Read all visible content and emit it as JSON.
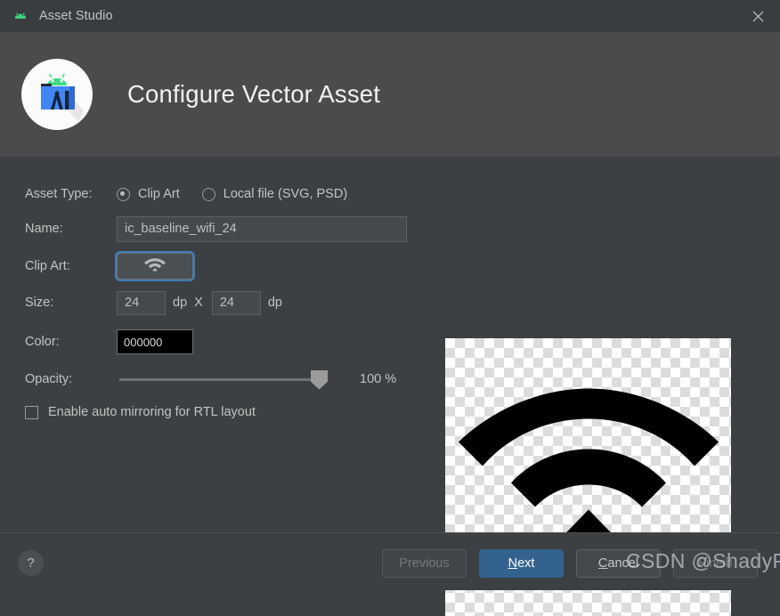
{
  "window": {
    "app_icon": "android-icon",
    "title": "Asset Studio",
    "close_icon": "close-icon"
  },
  "header": {
    "logo_icon": "android-studio-logo",
    "title": "Configure Vector Asset"
  },
  "form": {
    "asset_type": {
      "label": "Asset Type:",
      "options": [
        {
          "label": "Clip Art",
          "selected": true
        },
        {
          "label": "Local file (SVG, PSD)",
          "selected": false
        }
      ]
    },
    "name": {
      "label": "Name:",
      "value": "ic_baseline_wifi_24",
      "placeholder": "ic_baseline_wifi_24"
    },
    "clip_art": {
      "label": "Clip Art:",
      "icon": "wifi-icon",
      "focused": true
    },
    "size": {
      "label": "Size:",
      "width": "24",
      "height": "24",
      "unit_1": "dp",
      "separator": "X",
      "unit_2": "dp"
    },
    "color": {
      "label": "Color:",
      "value": "000000",
      "swatch_hex": "#000000"
    },
    "opacity": {
      "label": "Opacity:",
      "percent": 100,
      "value_text": "100 %"
    },
    "mirroring": {
      "label": "Enable auto mirroring for RTL layout",
      "checked": false
    }
  },
  "preview": {
    "icon": "wifi-icon",
    "icon_color": "#000000",
    "background": "transparency-checkerboard"
  },
  "footer": {
    "help_label": "?",
    "buttons": [
      {
        "label": "Previous",
        "state": "disabled",
        "mnemonic": ""
      },
      {
        "label": "Next",
        "state": "primary",
        "mnemonic": "N"
      },
      {
        "label": "Cancel",
        "state": "normal",
        "mnemonic": "C"
      },
      {
        "label": "Finish",
        "state": "disabled",
        "mnemonic": ""
      }
    ]
  },
  "watermark": {
    "text": "CSDN @ShadyPi"
  },
  "colors": {
    "titlebar": "#3a3d40",
    "header_band": "#4a4b4d",
    "body": "#3c4043",
    "accent_blue": "#33628f",
    "focus_ring": "#3f7cb5"
  }
}
